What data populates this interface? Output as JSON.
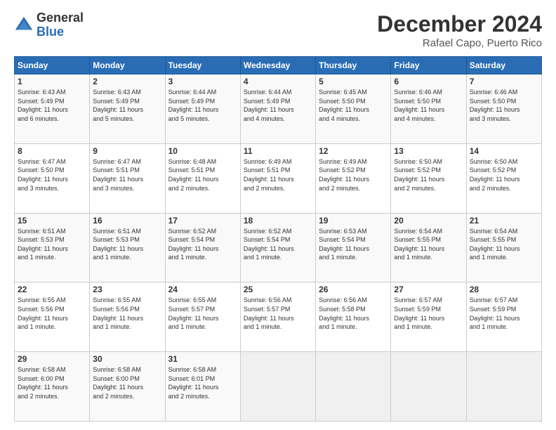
{
  "header": {
    "logo_general": "General",
    "logo_blue": "Blue",
    "title": "December 2024",
    "subtitle": "Rafael Capo, Puerto Rico"
  },
  "days_of_week": [
    "Sunday",
    "Monday",
    "Tuesday",
    "Wednesday",
    "Thursday",
    "Friday",
    "Saturday"
  ],
  "weeks": [
    [
      {
        "day": "1",
        "sunrise": "6:43 AM",
        "sunset": "5:49 PM",
        "daylight": "11 hours and 6 minutes."
      },
      {
        "day": "2",
        "sunrise": "6:43 AM",
        "sunset": "5:49 PM",
        "daylight": "11 hours and 5 minutes."
      },
      {
        "day": "3",
        "sunrise": "6:44 AM",
        "sunset": "5:49 PM",
        "daylight": "11 hours and 5 minutes."
      },
      {
        "day": "4",
        "sunrise": "6:44 AM",
        "sunset": "5:49 PM",
        "daylight": "11 hours and 4 minutes."
      },
      {
        "day": "5",
        "sunrise": "6:45 AM",
        "sunset": "5:50 PM",
        "daylight": "11 hours and 4 minutes."
      },
      {
        "day": "6",
        "sunrise": "6:46 AM",
        "sunset": "5:50 PM",
        "daylight": "11 hours and 4 minutes."
      },
      {
        "day": "7",
        "sunrise": "6:46 AM",
        "sunset": "5:50 PM",
        "daylight": "11 hours and 3 minutes."
      }
    ],
    [
      {
        "day": "8",
        "sunrise": "6:47 AM",
        "sunset": "5:50 PM",
        "daylight": "11 hours and 3 minutes."
      },
      {
        "day": "9",
        "sunrise": "6:47 AM",
        "sunset": "5:51 PM",
        "daylight": "11 hours and 3 minutes."
      },
      {
        "day": "10",
        "sunrise": "6:48 AM",
        "sunset": "5:51 PM",
        "daylight": "11 hours and 2 minutes."
      },
      {
        "day": "11",
        "sunrise": "6:49 AM",
        "sunset": "5:51 PM",
        "daylight": "11 hours and 2 minutes."
      },
      {
        "day": "12",
        "sunrise": "6:49 AM",
        "sunset": "5:52 PM",
        "daylight": "11 hours and 2 minutes."
      },
      {
        "day": "13",
        "sunrise": "6:50 AM",
        "sunset": "5:52 PM",
        "daylight": "11 hours and 2 minutes."
      },
      {
        "day": "14",
        "sunrise": "6:50 AM",
        "sunset": "5:52 PM",
        "daylight": "11 hours and 2 minutes."
      }
    ],
    [
      {
        "day": "15",
        "sunrise": "6:51 AM",
        "sunset": "5:53 PM",
        "daylight": "11 hours and 1 minute."
      },
      {
        "day": "16",
        "sunrise": "6:51 AM",
        "sunset": "5:53 PM",
        "daylight": "11 hours and 1 minute."
      },
      {
        "day": "17",
        "sunrise": "6:52 AM",
        "sunset": "5:54 PM",
        "daylight": "11 hours and 1 minute."
      },
      {
        "day": "18",
        "sunrise": "6:52 AM",
        "sunset": "5:54 PM",
        "daylight": "11 hours and 1 minute."
      },
      {
        "day": "19",
        "sunrise": "6:53 AM",
        "sunset": "5:54 PM",
        "daylight": "11 hours and 1 minute."
      },
      {
        "day": "20",
        "sunrise": "6:54 AM",
        "sunset": "5:55 PM",
        "daylight": "11 hours and 1 minute."
      },
      {
        "day": "21",
        "sunrise": "6:54 AM",
        "sunset": "5:55 PM",
        "daylight": "11 hours and 1 minute."
      }
    ],
    [
      {
        "day": "22",
        "sunrise": "6:55 AM",
        "sunset": "5:56 PM",
        "daylight": "11 hours and 1 minute."
      },
      {
        "day": "23",
        "sunrise": "6:55 AM",
        "sunset": "5:56 PM",
        "daylight": "11 hours and 1 minute."
      },
      {
        "day": "24",
        "sunrise": "6:55 AM",
        "sunset": "5:57 PM",
        "daylight": "11 hours and 1 minute."
      },
      {
        "day": "25",
        "sunrise": "6:56 AM",
        "sunset": "5:57 PM",
        "daylight": "11 hours and 1 minute."
      },
      {
        "day": "26",
        "sunrise": "6:56 AM",
        "sunset": "5:58 PM",
        "daylight": "11 hours and 1 minute."
      },
      {
        "day": "27",
        "sunrise": "6:57 AM",
        "sunset": "5:59 PM",
        "daylight": "11 hours and 1 minute."
      },
      {
        "day": "28",
        "sunrise": "6:57 AM",
        "sunset": "5:59 PM",
        "daylight": "11 hours and 1 minute."
      }
    ],
    [
      {
        "day": "29",
        "sunrise": "6:58 AM",
        "sunset": "6:00 PM",
        "daylight": "11 hours and 2 minutes."
      },
      {
        "day": "30",
        "sunrise": "6:58 AM",
        "sunset": "6:00 PM",
        "daylight": "11 hours and 2 minutes."
      },
      {
        "day": "31",
        "sunrise": "6:58 AM",
        "sunset": "6:01 PM",
        "daylight": "11 hours and 2 minutes."
      },
      null,
      null,
      null,
      null
    ]
  ]
}
